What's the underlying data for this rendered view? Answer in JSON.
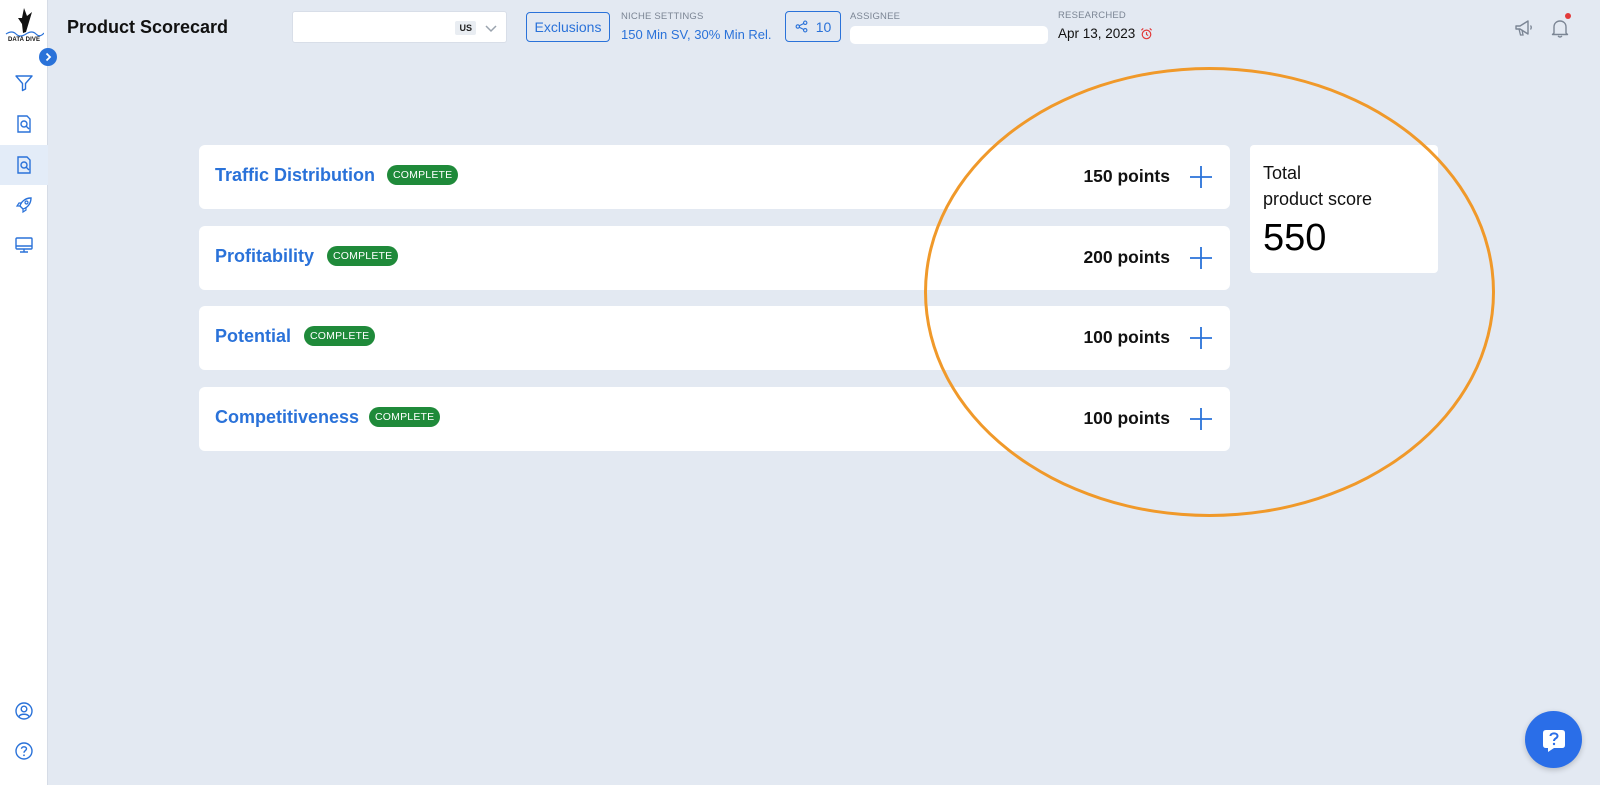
{
  "app": {
    "logo_text": "DATA DIVE"
  },
  "header": {
    "title": "Product Scorecard",
    "product_select": {
      "value": "",
      "market": "US"
    },
    "exclusions_label": "Exclusions",
    "niche_settings": {
      "label": "NICHE SETTINGS",
      "value": "150 Min SV, 30% Min Rel."
    },
    "share_count": "10",
    "assignee": {
      "label": "ASSIGNEE",
      "value": ""
    },
    "researched": {
      "label": "RESEARCHED",
      "value": "Apr 13, 2023"
    }
  },
  "score_rows": [
    {
      "title": "Traffic Distribution",
      "status": "COMPLETE",
      "points": "150 points"
    },
    {
      "title": "Profitability",
      "status": "COMPLETE",
      "points": "200 points"
    },
    {
      "title": "Potential",
      "status": "COMPLETE",
      "points": "100 points"
    },
    {
      "title": "Competitiveness",
      "status": "COMPLETE",
      "points": "100 points"
    }
  ],
  "total": {
    "label_line1": "Total",
    "label_line2": "product score",
    "value": "550"
  },
  "colors": {
    "accent": "#2a72d9",
    "complete": "#1f8a3a",
    "highlight": "#f0992a",
    "background": "#e3e9f2"
  },
  "icons": {
    "sidebar": [
      "filter-icon",
      "search-document-icon",
      "search-document-icon",
      "rocket-icon",
      "monitor-icon",
      "user-circle-icon",
      "help-circle-icon"
    ],
    "header": [
      "megaphone-icon",
      "bell-icon"
    ],
    "rows": "plus-icon"
  }
}
